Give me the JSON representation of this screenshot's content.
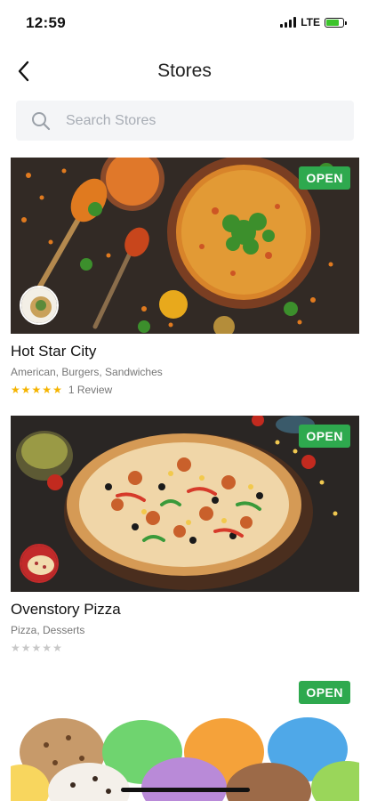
{
  "status_bar": {
    "time": "12:59",
    "network": "LTE"
  },
  "header": {
    "title": "Stores"
  },
  "search": {
    "placeholder": "Search Stores"
  },
  "stores": [
    {
      "name": "Hot Star City",
      "cuisine": "American, Burgers, Sandwiches",
      "status": "OPEN",
      "rating": 5,
      "reviews": "1 Review"
    },
    {
      "name": "Ovenstory Pizza",
      "cuisine": "Pizza, Desserts",
      "status": "OPEN",
      "rating": 0,
      "reviews": ""
    },
    {
      "name": "",
      "cuisine": "",
      "status": "OPEN",
      "rating": 0,
      "reviews": ""
    }
  ],
  "colors": {
    "open_badge": "#2ea94e",
    "star": "#f5b400",
    "star_empty": "#c8c8c8",
    "search_bg": "#f4f5f7"
  }
}
